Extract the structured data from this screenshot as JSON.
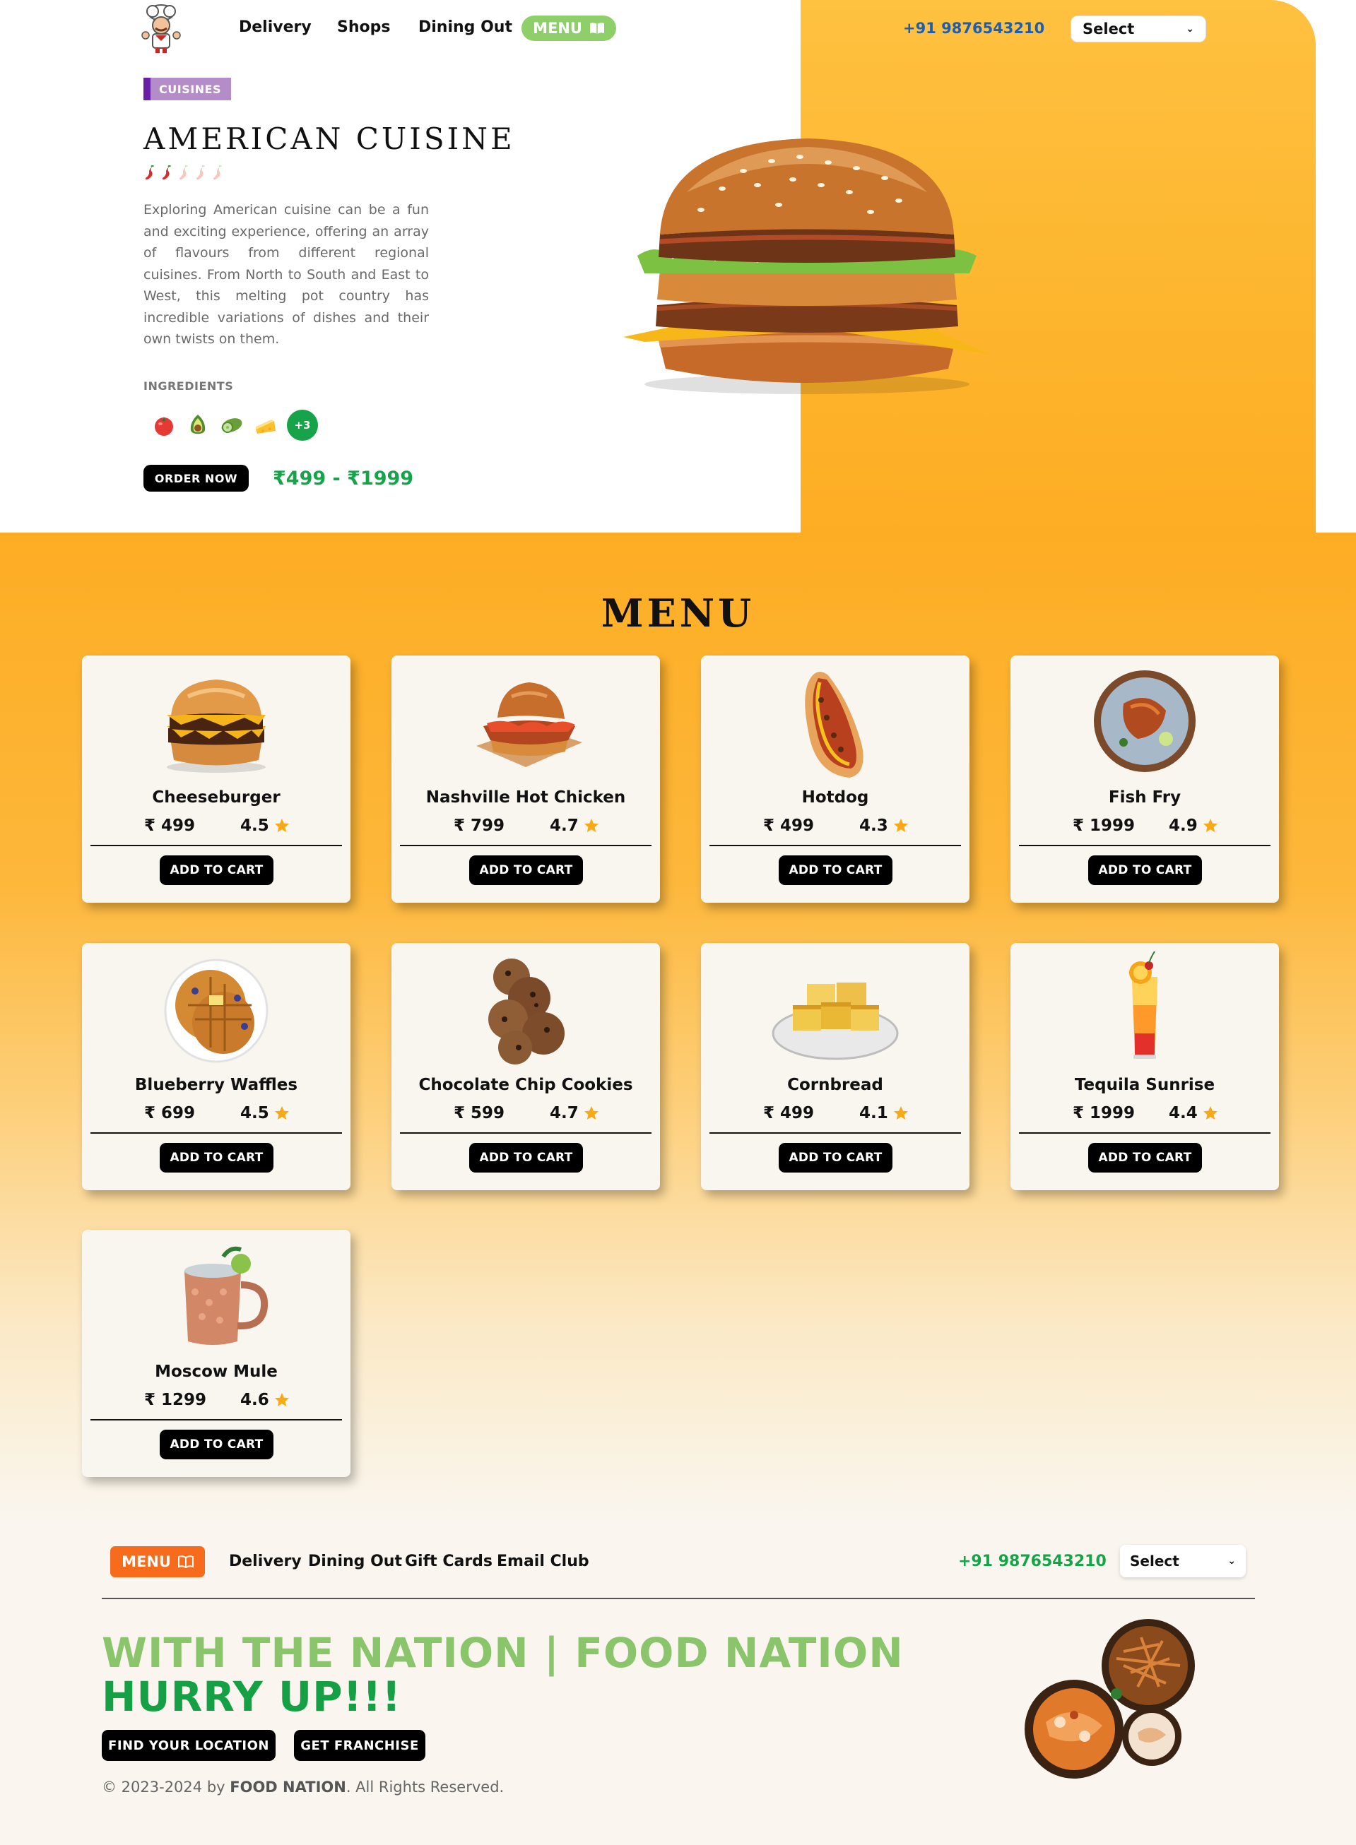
{
  "header": {
    "nav": [
      "Delivery",
      "Shops",
      "Dining Out"
    ],
    "menu_label": "MENU",
    "phone": "+91 9876543210",
    "select_label": "Select"
  },
  "hero": {
    "tag": "CUISINES",
    "title": "AMERICAN CUISINE",
    "spice_level": 2,
    "spice_max": 5,
    "description": "Exploring American cuisine can be a fun and exciting experience, offering an array of flavours from different regional cuisines. From North to South and East to West, this melting pot country has incredible variations of dishes and their own twists on them.",
    "ingredients_label": "INGREDIENTS",
    "ingredients": [
      "tomato-icon",
      "avocado-icon",
      "cucumber-icon",
      "cheese-icon"
    ],
    "more_ingredients": "+3",
    "order_label": "ORDER NOW",
    "price_range": "₹499 - ₹1999",
    "colors": {
      "accent_orange": "#fdb52d",
      "price_green": "#17a34a",
      "tag_purple": "#b48cc8"
    }
  },
  "menu": {
    "title": "MENU",
    "currency": "₹",
    "cart_label": "ADD TO CART",
    "items": [
      {
        "name": "Cheeseburger",
        "price": "499",
        "rating": "4.5",
        "image": "cheeseburger"
      },
      {
        "name": "Nashville Hot Chicken",
        "price": "799",
        "rating": "4.7",
        "image": "chicken-sandwich"
      },
      {
        "name": "Hotdog",
        "price": "499",
        "rating": "4.3",
        "image": "hotdog"
      },
      {
        "name": "Fish Fry",
        "price": "1999",
        "rating": "4.9",
        "image": "fish-plate"
      },
      {
        "name": "Blueberry Waffles",
        "price": "699",
        "rating": "4.5",
        "image": "waffles"
      },
      {
        "name": "Chocolate Chip Cookies",
        "price": "599",
        "rating": "4.7",
        "image": "cookies"
      },
      {
        "name": "Cornbread",
        "price": "499",
        "rating": "4.1",
        "image": "cornbread"
      },
      {
        "name": "Tequila Sunrise",
        "price": "1999",
        "rating": "4.4",
        "image": "cocktail"
      },
      {
        "name": "Moscow Mule",
        "price": "1299",
        "rating": "4.6",
        "image": "copper-mug"
      }
    ]
  },
  "footer": {
    "menu_label": "MENU",
    "links": [
      "Delivery",
      "Dining Out",
      "Gift Cards",
      "Email Club"
    ],
    "phone": "+91 9876543210",
    "select_label": "Select",
    "slogan_line1": "WITH THE NATION | FOOD NATION",
    "slogan_line2": "HURRY UP!!!",
    "find_location": "FIND YOUR LOCATION",
    "franchise": "GET FRANCHISE",
    "copyright_prefix": "© 2023-2024 by ",
    "brand": "FOOD NATION",
    "copyright_suffix": ". All Rights Reserved."
  }
}
